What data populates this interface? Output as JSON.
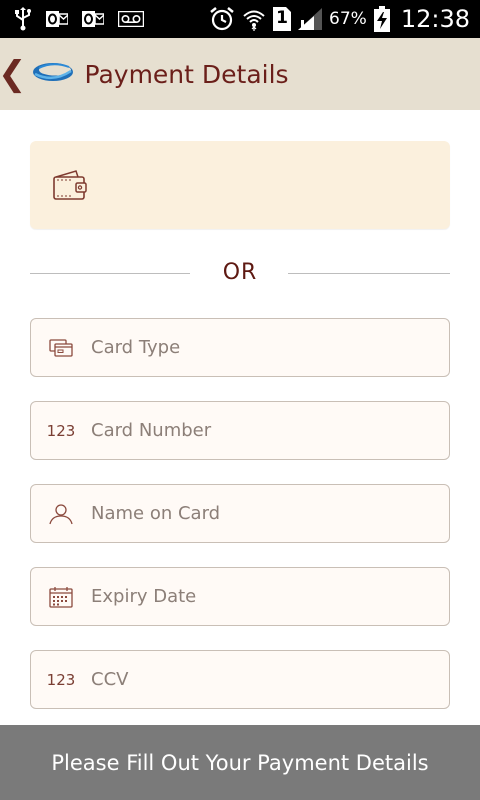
{
  "status_bar": {
    "icons_left": [
      "usb-icon",
      "outlook-icon",
      "outlook-icon",
      "voicemail-icon"
    ],
    "icons_right": [
      "alarm-icon",
      "wifi-icon",
      "sim-icon",
      "signal-icon",
      "battery-charging-icon"
    ],
    "sim_label": "1",
    "battery_percent": "67%",
    "time": "12:38"
  },
  "header": {
    "back_glyph": "❮",
    "title": "Payment Details"
  },
  "divider": {
    "label": "OR"
  },
  "form": {
    "fields": [
      {
        "placeholder": "Card Type",
        "icon": "card-icon"
      },
      {
        "placeholder": "Card Number",
        "icon": "number-icon",
        "icon_text": "123"
      },
      {
        "placeholder": "Name on Card",
        "icon": "user-icon"
      },
      {
        "placeholder": "Expiry Date",
        "icon": "calendar-icon"
      },
      {
        "placeholder": "CCV",
        "icon": "number-icon",
        "icon_text": "123"
      }
    ]
  },
  "bottom_bar": {
    "label": "Please Fill Out Your Payment Details"
  },
  "colors": {
    "header_bg": "#e6dfd0",
    "title": "#6b1f1a",
    "wallet_bg": "#fbf0dd",
    "field_bg": "#fffaf6",
    "bottom_bar_bg": "#7a7a7a"
  }
}
